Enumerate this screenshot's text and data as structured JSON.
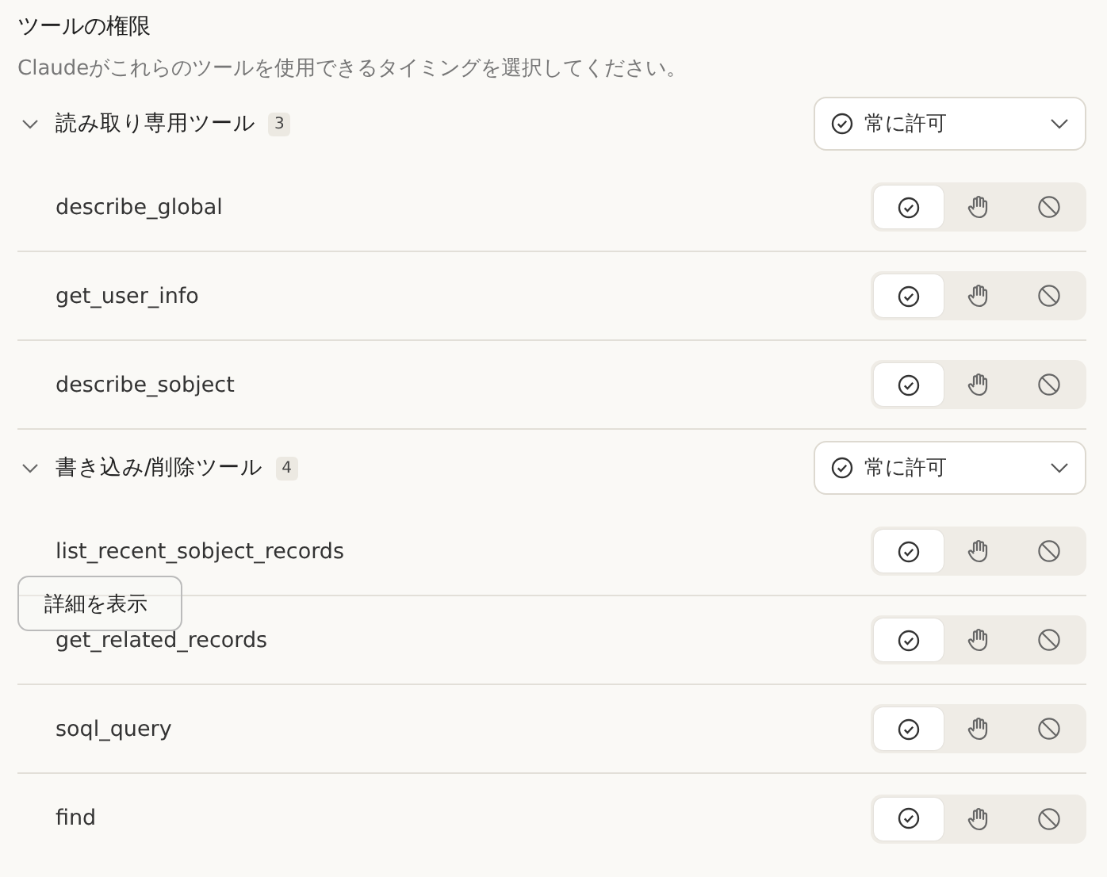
{
  "title": "ツールの権限",
  "subtitle": "Claudeがこれらのツールを使用できるタイミングを選択してください。",
  "groups": [
    {
      "label": "読み取り専用ツール",
      "count": "3",
      "expanded": true,
      "policy": {
        "label": "常に許可"
      },
      "tools": [
        {
          "name": "describe_global",
          "options": [
            {
              "kind": "allow",
              "selected": true
            },
            {
              "kind": "ask",
              "selected": false
            },
            {
              "kind": "deny",
              "selected": false
            }
          ]
        },
        {
          "name": "get_user_info",
          "options": [
            {
              "kind": "allow",
              "selected": true
            },
            {
              "kind": "ask",
              "selected": false
            },
            {
              "kind": "deny",
              "selected": false
            }
          ]
        },
        {
          "name": "describe_sobject",
          "options": [
            {
              "kind": "allow",
              "selected": true
            },
            {
              "kind": "ask",
              "selected": false
            },
            {
              "kind": "deny",
              "selected": false
            }
          ]
        }
      ]
    },
    {
      "label": "書き込み/削除ツール",
      "count": "4",
      "expanded": true,
      "policy": {
        "label": "常に許可"
      },
      "tools": [
        {
          "name": "list_recent_sobject_records",
          "options": [
            {
              "kind": "allow",
              "selected": true
            },
            {
              "kind": "ask",
              "selected": false
            },
            {
              "kind": "deny",
              "selected": false
            }
          ]
        },
        {
          "name": "get_related_records",
          "options": [
            {
              "kind": "allow",
              "selected": true
            },
            {
              "kind": "ask",
              "selected": false
            },
            {
              "kind": "deny",
              "selected": false
            }
          ]
        },
        {
          "name": "soql_query",
          "options": [
            {
              "kind": "allow",
              "selected": true
            },
            {
              "kind": "ask",
              "selected": false
            },
            {
              "kind": "deny",
              "selected": false
            }
          ]
        },
        {
          "name": "find",
          "options": [
            {
              "kind": "allow",
              "selected": true
            },
            {
              "kind": "ask",
              "selected": false
            },
            {
              "kind": "deny",
              "selected": false
            }
          ]
        }
      ]
    }
  ],
  "overlay_button": {
    "label": "詳細を表示"
  }
}
